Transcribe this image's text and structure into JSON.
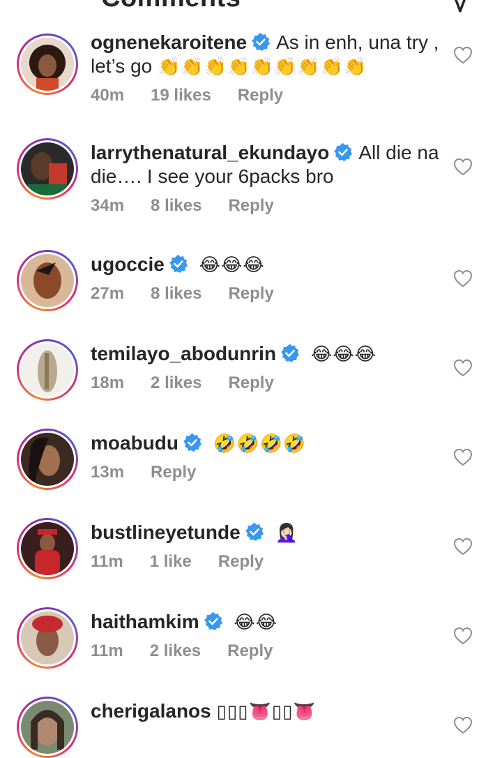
{
  "header": {
    "title": "Comments"
  },
  "comments": [
    {
      "username": "ognenekaroitene",
      "text": "As in enh, una try , let’s go",
      "emoji": "👏👏👏👏👏👏👏👏👏",
      "time": "40m",
      "likes": "19 likes",
      "reply": "Reply",
      "avatar_color": "#5a3a2a"
    },
    {
      "username": "larrythenatural_ekundayo",
      "text": "All die na die…. I see your 6packs bro",
      "emoji": "",
      "time": "34m",
      "likes": "8 likes",
      "reply": "Reply",
      "avatar_color": "#3a2a22"
    },
    {
      "username": "ugoccie",
      "text": "",
      "emoji": "😂😂😂",
      "time": "27m",
      "likes": "8 likes",
      "reply": "Reply",
      "avatar_color": "#9a5a3a"
    },
    {
      "username": "temilayo_abodunrin",
      "text": "",
      "emoji": "😂😂😂",
      "time": "18m",
      "likes": "2 likes",
      "reply": "Reply",
      "avatar_color": "#c9c2b4"
    },
    {
      "username": "moabudu",
      "text": "",
      "emoji": "🤣🤣🤣🤣",
      "time": "13m",
      "likes": "",
      "reply": "Reply",
      "avatar_color": "#6b4430"
    },
    {
      "username": "bustlineyetunde",
      "text": "",
      "emoji": "🤦🏻‍♀️",
      "time": "11m",
      "likes": "1 like",
      "reply": "Reply",
      "avatar_color": "#b0262a"
    },
    {
      "username": "haithamkim",
      "text": "",
      "emoji": "😂😂",
      "time": "11m",
      "likes": "2 likes",
      "reply": "Reply",
      "avatar_color": "#5a3a2e"
    },
    {
      "username": "cherigalanos",
      "text": "",
      "emoji": "▯▯▯👅▯▯👅",
      "time": "",
      "likes": "",
      "reply": "",
      "avatar_color": "#4a3b36"
    }
  ]
}
